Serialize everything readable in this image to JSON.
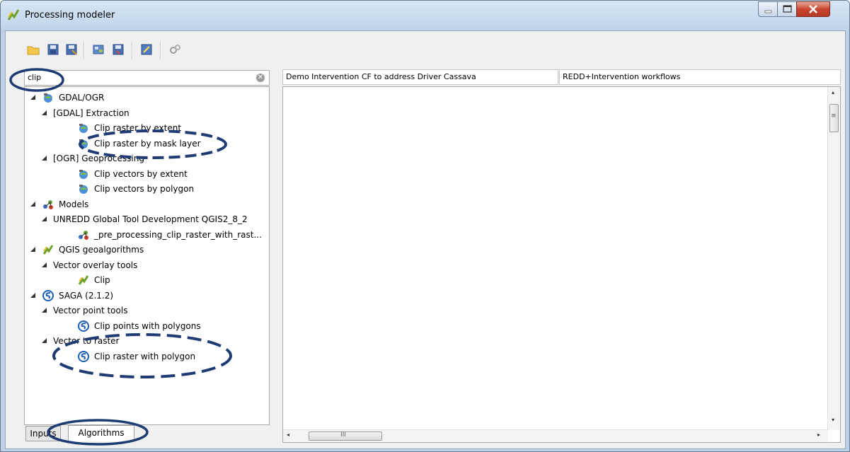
{
  "window": {
    "title": "Processing modeler"
  },
  "toolbar": {
    "buttons": [
      {
        "name": "open-model",
        "icon": "folder-open-icon"
      },
      {
        "name": "save-model",
        "icon": "save-icon"
      },
      {
        "name": "save-model-as",
        "icon": "save-as-icon"
      },
      {
        "name": "export-image",
        "icon": "export-image-icon"
      },
      {
        "name": "export-python",
        "icon": "export-python-icon"
      },
      {
        "name": "edit-help",
        "icon": "edit-help-icon"
      },
      {
        "name": "run-model",
        "icon": "run-gears-icon"
      }
    ]
  },
  "search": {
    "value": "clip",
    "placeholder": ""
  },
  "tree": [
    {
      "level": 0,
      "label": "GDAL/OGR",
      "icon": "gdal-icon",
      "expanded": true
    },
    {
      "level": 1,
      "label": "[GDAL] Extraction",
      "expanded": true
    },
    {
      "level": 2,
      "label": "Clip raster by extent",
      "icon": "gdal-icon"
    },
    {
      "level": 2,
      "label": "Clip raster by mask layer",
      "icon": "gdal-icon"
    },
    {
      "level": 1,
      "label": "[OGR] Geoprocessing",
      "expanded": true
    },
    {
      "level": 2,
      "label": "Clip vectors by extent",
      "icon": "gdal-icon"
    },
    {
      "level": 2,
      "label": "Clip vectors by polygon",
      "icon": "gdal-icon"
    },
    {
      "level": 0,
      "label": "Models",
      "icon": "models-icon",
      "expanded": true
    },
    {
      "level": 1,
      "label": "UNREDD Global Tool Development QGIS2_8_2",
      "expanded": true
    },
    {
      "level": 2,
      "label": "_pre_processing_clip_raster_with_rast...",
      "icon": "models-icon"
    },
    {
      "level": 0,
      "label": "QGIS geoalgorithms",
      "icon": "qgis-icon",
      "expanded": true
    },
    {
      "level": 1,
      "label": "Vector overlay tools",
      "expanded": true
    },
    {
      "level": 2,
      "label": "Clip",
      "icon": "qgis-icon"
    },
    {
      "level": 0,
      "label": "SAGA (2.1.2)",
      "icon": "saga-icon",
      "expanded": true
    },
    {
      "level": 1,
      "label": "Vector point tools",
      "expanded": true
    },
    {
      "level": 2,
      "label": "Clip points with polygons",
      "icon": "saga-icon"
    },
    {
      "level": 1,
      "label": "Vector to raster",
      "expanded": true
    },
    {
      "level": 2,
      "label": "Clip raster with polygon",
      "icon": "saga-icon"
    }
  ],
  "tabs": {
    "inputs": "Inputs",
    "algorithms": "Algorithms"
  },
  "model": {
    "name": "Demo Intervention CF to address Driver Cassava",
    "group": "REDD+Intervention workflows"
  },
  "scroll": {
    "h_arrow_left": "◂",
    "h_arrow_right": "▸",
    "v_arrow_up": "▴",
    "v_arrow_down": "▾",
    "h_grip": "III",
    "v_grip": "≡"
  },
  "colors": {
    "annotation": "#1f3b73",
    "selection": "#cce4f7"
  }
}
